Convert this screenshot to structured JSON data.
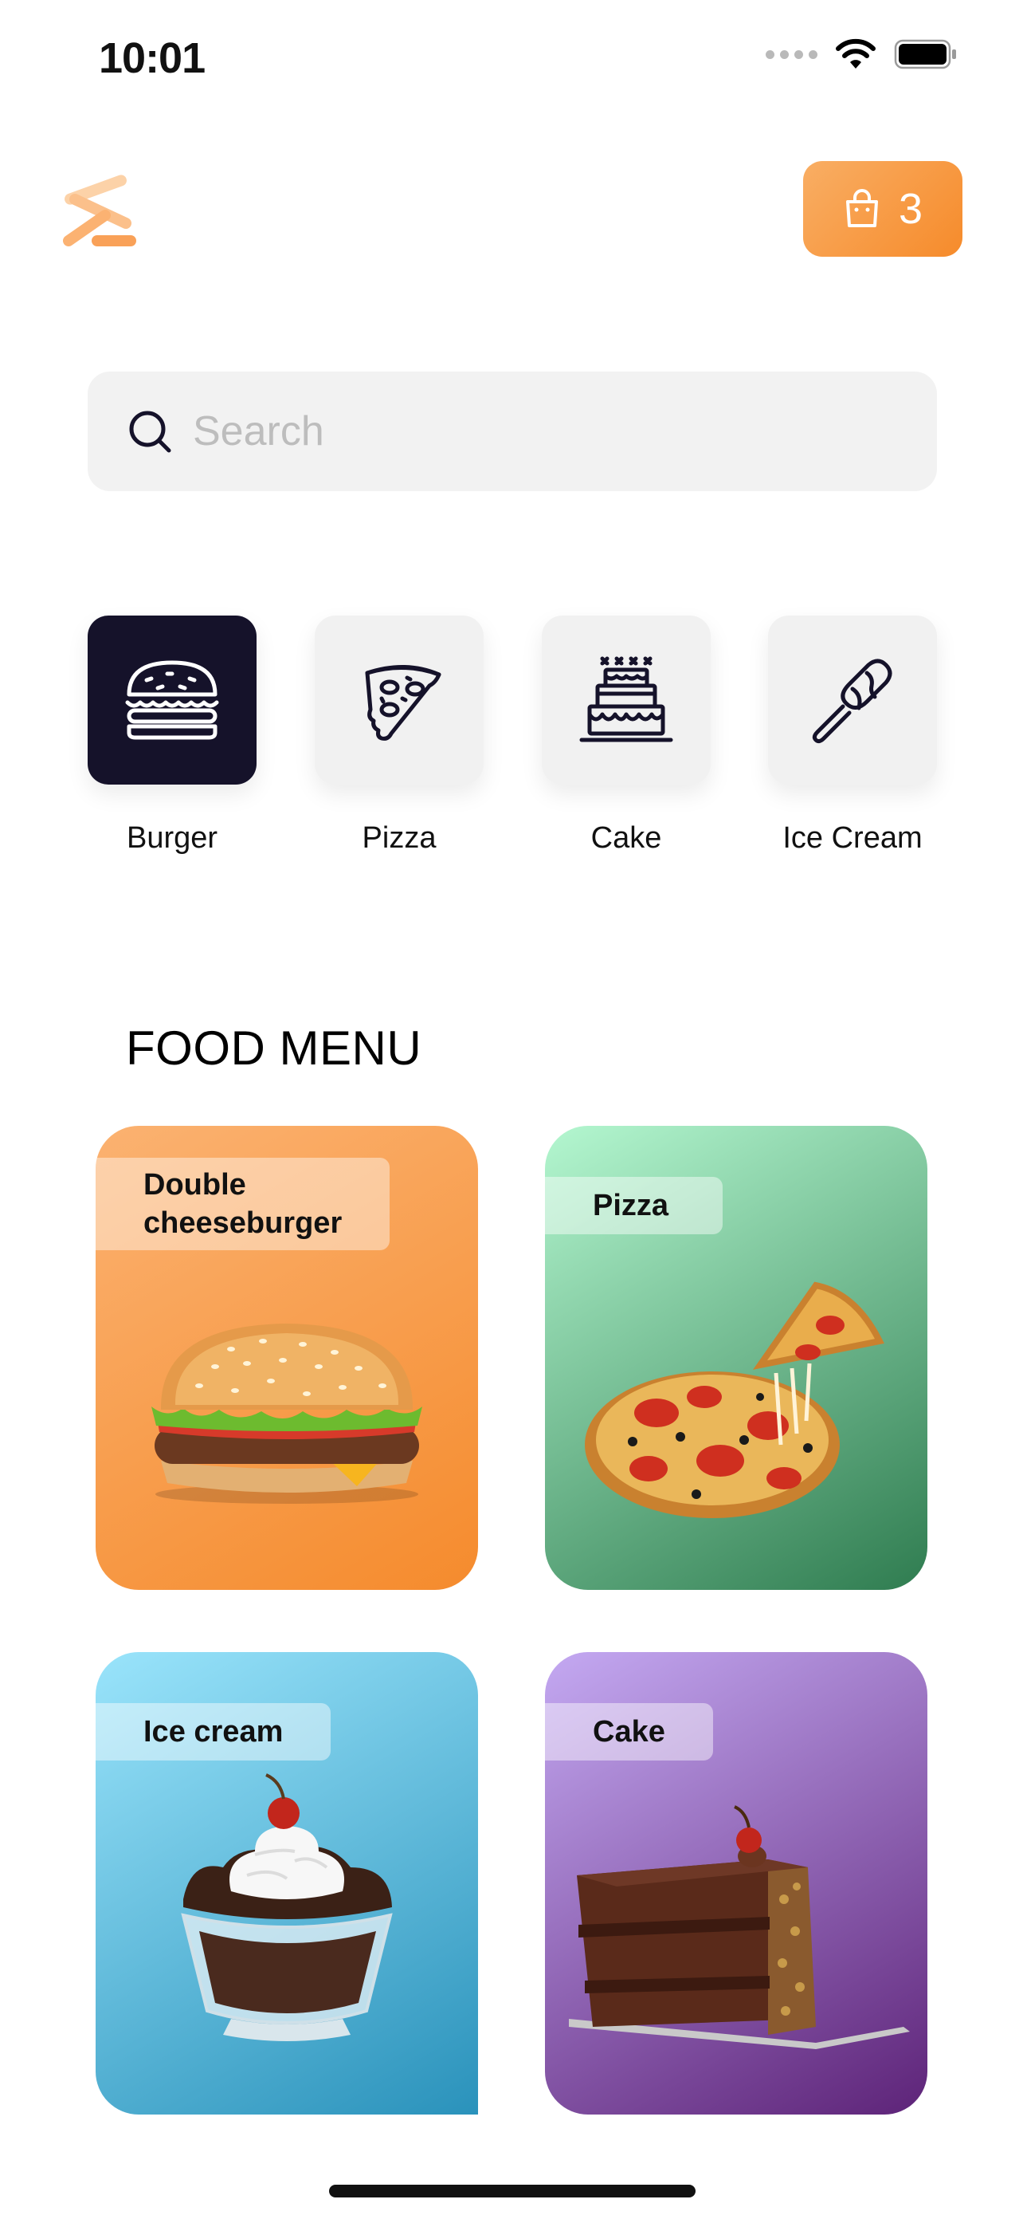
{
  "status_bar": {
    "time": "10:01"
  },
  "header": {
    "cart_count": "3"
  },
  "search": {
    "placeholder": "Search",
    "value": ""
  },
  "categories": [
    {
      "label": "Burger",
      "icon": "burger-icon",
      "active": true
    },
    {
      "label": "Pizza",
      "icon": "pizza-slice-icon",
      "active": false
    },
    {
      "label": "Cake",
      "icon": "cake-icon",
      "active": false
    },
    {
      "label": "Ice Cream",
      "icon": "ice-cream-bar-icon",
      "active": false
    }
  ],
  "section_title": "FOOD MENU",
  "menu": [
    {
      "label_line1": "Double",
      "label_line2": "cheeseburger",
      "image": "burger-image"
    },
    {
      "label": "Pizza",
      "image": "pizza-image"
    },
    {
      "label": "Ice cream",
      "image": "ice-cream-sundae-image"
    },
    {
      "label": "Cake",
      "image": "chocolate-cake-image"
    }
  ],
  "colors": {
    "accent": "#f68b2b",
    "active_tile": "#15122a",
    "tile": "#f1f1f1"
  }
}
